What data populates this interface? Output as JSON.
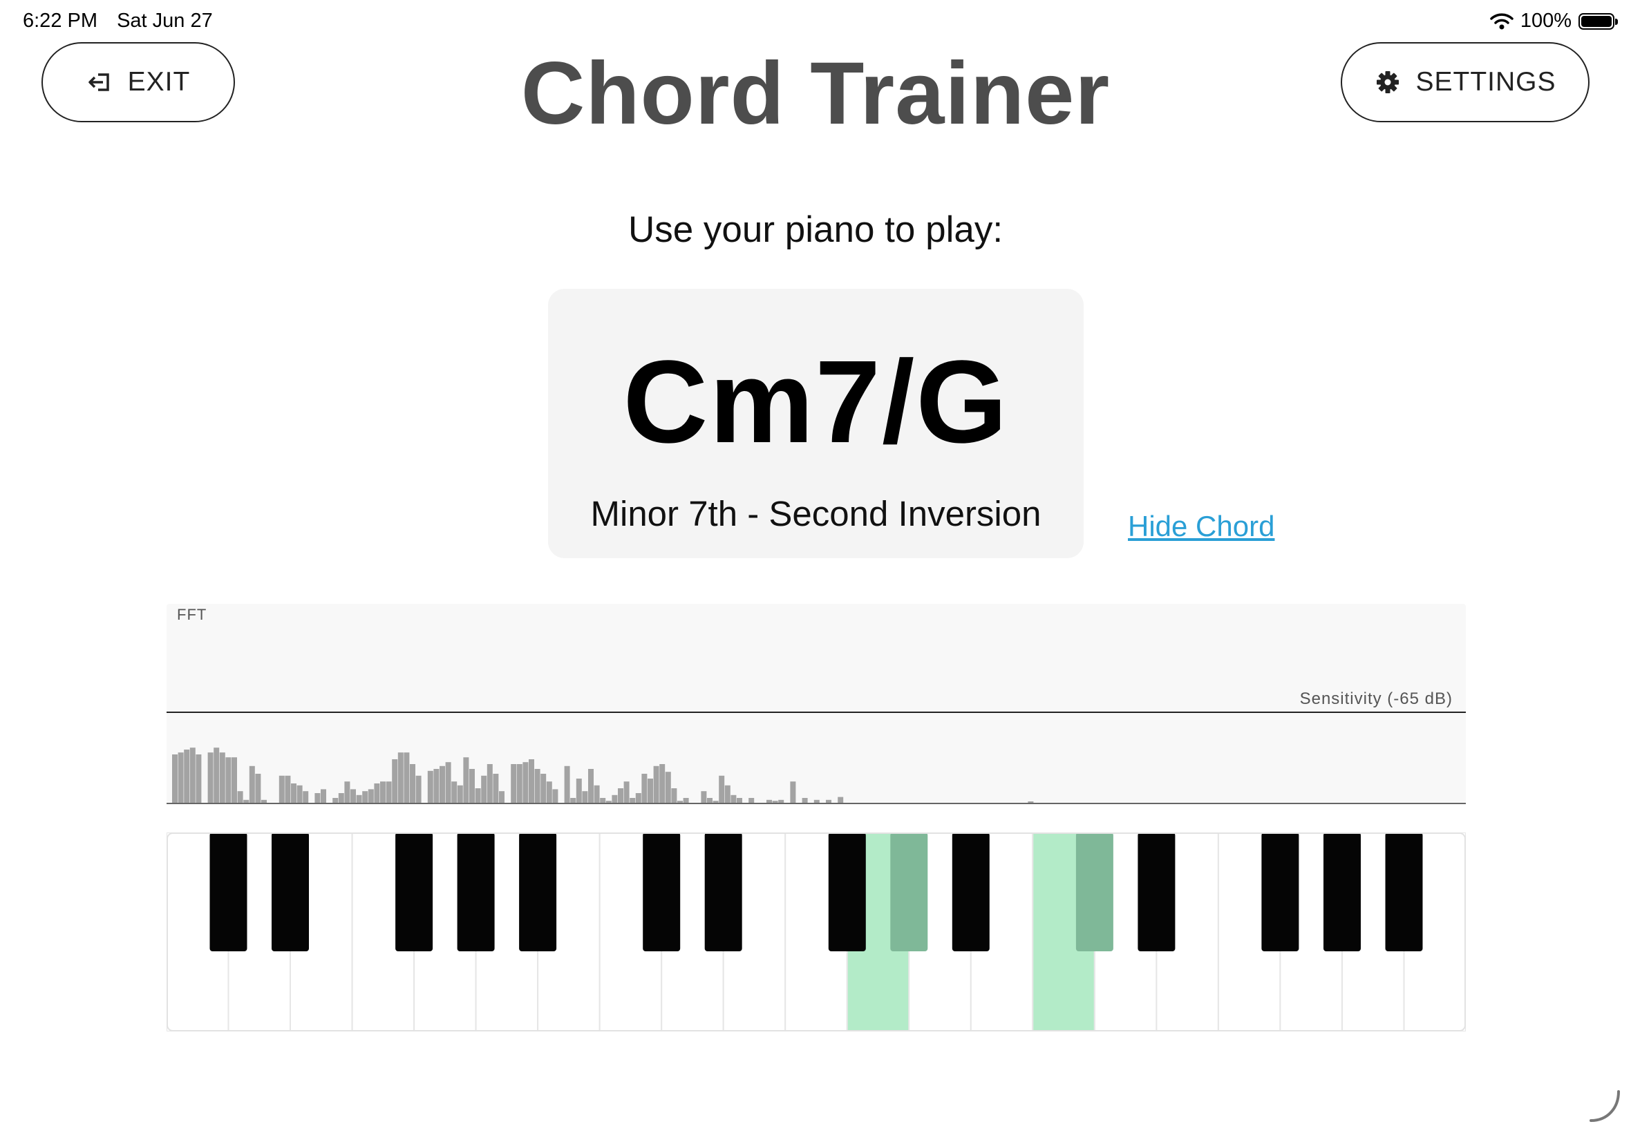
{
  "status_bar": {
    "time": "6:22 PM",
    "date": "Sat Jun 27",
    "battery": "100%"
  },
  "header": {
    "exit_label": "EXIT",
    "settings_label": "SETTINGS",
    "title": "Chord Trainer"
  },
  "prompt": "Use your piano to play:",
  "chord": {
    "name": "Cm7/G",
    "description": "Minor 7th - Second Inversion",
    "hide_link": "Hide Chord"
  },
  "fft": {
    "label": "FFT",
    "sensitivity_label": "Sensitivity (-65 dB)",
    "levels": [
      0.5,
      0.52,
      0.55,
      0.57,
      0.5,
      0,
      0.52,
      0.57,
      0.52,
      0.47,
      0.47,
      0.12,
      0.03,
      0.38,
      0.3,
      0.03,
      0,
      0,
      0.28,
      0.28,
      0.2,
      0.18,
      0.12,
      0,
      0.1,
      0.14,
      0,
      0.05,
      0.1,
      0.22,
      0.14,
      0.08,
      0.12,
      0.14,
      0.2,
      0.22,
      0.22,
      0.45,
      0.52,
      0.52,
      0.4,
      0.28,
      0,
      0.33,
      0.35,
      0.38,
      0.42,
      0.22,
      0.18,
      0.47,
      0.35,
      0.15,
      0.28,
      0.4,
      0.3,
      0.12,
      0,
      0.4,
      0.4,
      0.42,
      0.45,
      0.35,
      0.3,
      0.22,
      0.14,
      0,
      0.38,
      0.05,
      0.25,
      0.12,
      0.35,
      0.18,
      0.05,
      0.02,
      0.08,
      0.15,
      0.22,
      0.05,
      0.1,
      0.3,
      0.25,
      0.38,
      0.4,
      0.32,
      0.15,
      0.02,
      0.05,
      0,
      0,
      0.12,
      0.05,
      0.02,
      0.28,
      0.18,
      0.08,
      0.05,
      0,
      0.05,
      0,
      0,
      0.03,
      0.02,
      0.03,
      0,
      0.22,
      0,
      0.05,
      0,
      0.03,
      0,
      0.03,
      0,
      0.06,
      0,
      0,
      0,
      0,
      0,
      0,
      0,
      0,
      0,
      0,
      0,
      0,
      0,
      0,
      0,
      0,
      0,
      0,
      0,
      0,
      0,
      0,
      0,
      0,
      0,
      0,
      0,
      0,
      0,
      0,
      0,
      0.01,
      0,
      0,
      0,
      0,
      0,
      0,
      0,
      0,
      0,
      0,
      0,
      0,
      0,
      0,
      0,
      0,
      0,
      0,
      0,
      0,
      0,
      0,
      0,
      0
    ]
  },
  "keyboard": {
    "white_count": 21,
    "black_after_white": [
      0,
      1,
      3,
      4,
      5,
      7,
      8,
      10,
      11,
      12,
      14,
      15,
      17,
      18,
      19
    ],
    "highlighted_white": [
      11,
      14
    ],
    "highlighted_black": [
      8,
      10
    ],
    "colors": {
      "white_highlight": "#b3ebc8",
      "black_highlight": "#7fb898"
    }
  }
}
